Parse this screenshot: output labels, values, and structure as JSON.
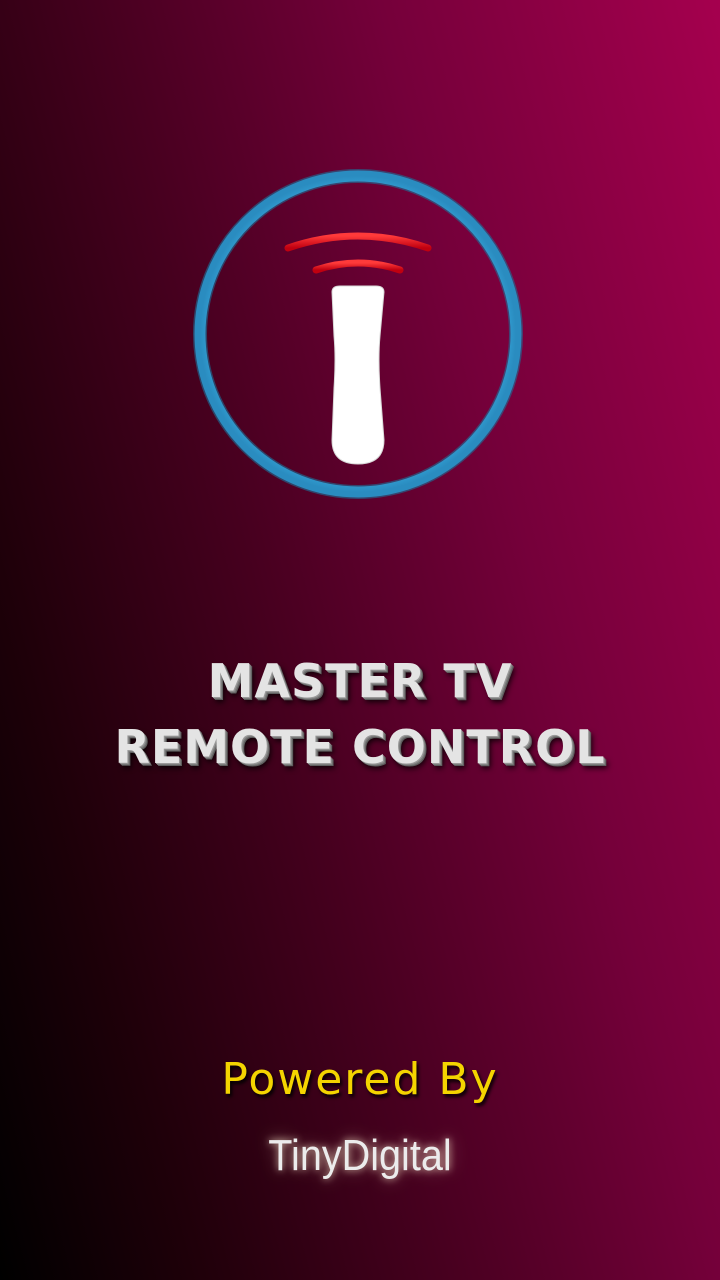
{
  "app": {
    "logo_icon": "remote-signal-icon",
    "title_line1": "MASTER TV",
    "title_line2": "REMOTE CONTROL"
  },
  "footer": {
    "powered_label": "Powered By",
    "brand_name": "TinyDigital"
  },
  "colors": {
    "ring": "#3aa8dc",
    "signal": "#e8141c",
    "remote": "#ffffff",
    "powered_text": "#f4d400",
    "background_start": "#000000",
    "background_end": "#a5004e"
  }
}
